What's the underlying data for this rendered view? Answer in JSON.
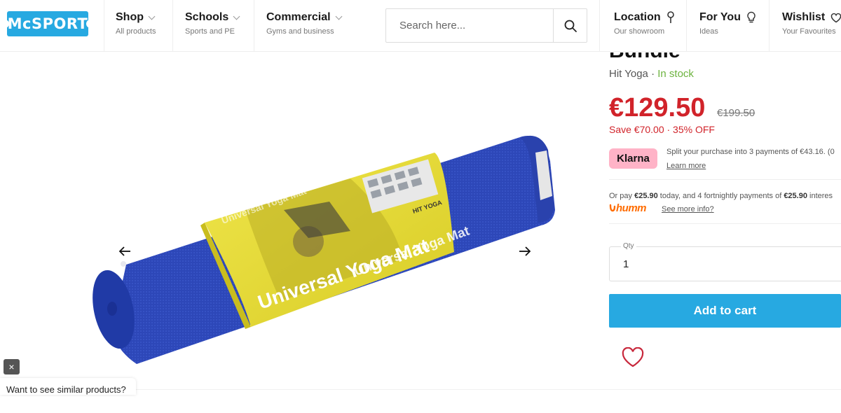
{
  "header": {
    "logo_text": "McSPORT",
    "nav": [
      {
        "label": "Shop",
        "sub": "All products",
        "has_chevron": true
      },
      {
        "label": "Schools",
        "sub": "Sports and PE",
        "has_chevron": true
      },
      {
        "label": "Commercial",
        "sub": "Gyms and business",
        "has_chevron": true
      }
    ],
    "search_placeholder": "Search here...",
    "right_nav": [
      {
        "label": "Location",
        "sub": "Our showroom",
        "icon": "pin-icon"
      },
      {
        "label": "For You",
        "sub": "Ideas",
        "icon": "lightbulb-icon"
      },
      {
        "label": "Wishlist",
        "sub": "Your Favourites",
        "icon": "heart-icon"
      }
    ]
  },
  "gallery": {
    "mat_band_text": "Universal Yoga Mat",
    "brand_mark": "HIT YOGA",
    "similar_prompt": "Want to see similar products?",
    "close_symbol": "×"
  },
  "product": {
    "title_fragment": "Bundle",
    "brand": "Hit Yoga",
    "separator": "·",
    "stock": "In stock",
    "price": "€129.50",
    "was_price": "€199.50",
    "save_text": "Save €70.00 · 35% OFF",
    "klarna": {
      "badge": "Klarna",
      "text": "Split your purchase into 3 payments of €43.16. (0",
      "link": "Learn more"
    },
    "humm": {
      "text_prefix": "Or pay ",
      "today_amount": "€25.90",
      "text_mid": " today, and 4 fortnightly payments of ",
      "fortnight_amount": "€25.90",
      "text_suffix": " interes",
      "logo": "humm",
      "link": "See more info?"
    },
    "qty_label": "Qty",
    "qty_value": "1",
    "add_to_cart": "Add to cart"
  },
  "colors": {
    "brand_blue": "#27a9e1",
    "price_red": "#d1232a",
    "stock_green": "#6cb33e",
    "klarna_pink": "#ffb3c7",
    "humm_orange": "#ff6c00"
  }
}
